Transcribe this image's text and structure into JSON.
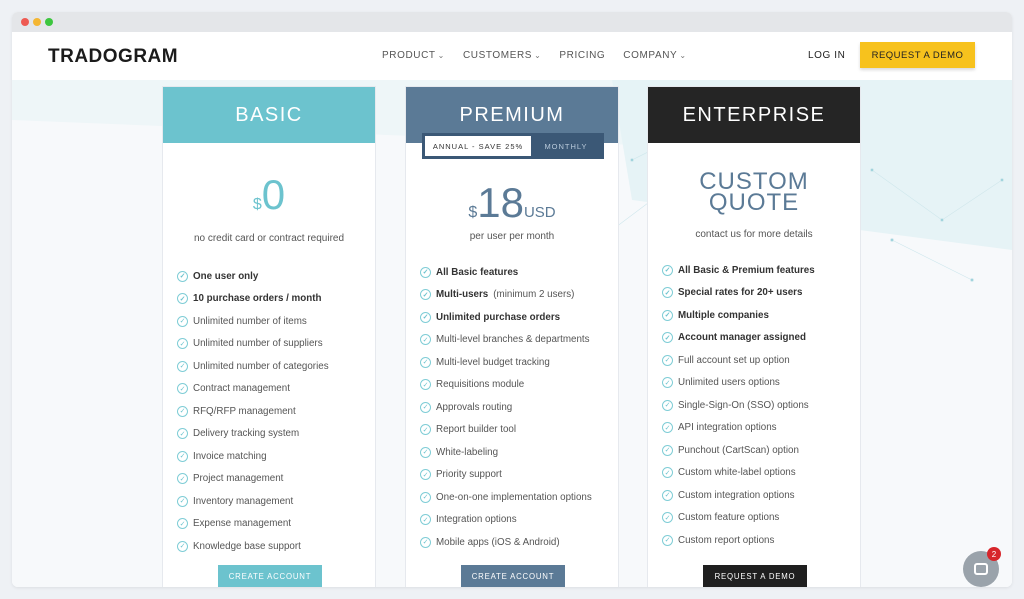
{
  "browser": {
    "controls": [
      "close",
      "minimize",
      "maximize"
    ]
  },
  "header": {
    "logo": "TRADOGRAM",
    "nav": [
      {
        "label": "PRODUCT",
        "dropdown": true
      },
      {
        "label": "CUSTOMERS",
        "dropdown": true
      },
      {
        "label": "PRICING",
        "dropdown": false
      },
      {
        "label": "COMPANY",
        "dropdown": true
      }
    ],
    "login": "LOG IN",
    "demo": "REQUEST A DEMO"
  },
  "plans": {
    "basic": {
      "name": "BASIC",
      "currency": "$",
      "amount": "0",
      "sub": "no credit card or contract required",
      "features": [
        {
          "text": "One user only",
          "bold": true
        },
        {
          "text": "10 purchase orders / month",
          "bold": true
        },
        {
          "text": "Unlimited number of items"
        },
        {
          "text": "Unlimited number of suppliers"
        },
        {
          "text": "Unlimited number of categories"
        },
        {
          "text": "Contract management"
        },
        {
          "text": "RFQ/RFP management"
        },
        {
          "text": "Delivery tracking system"
        },
        {
          "text": "Invoice matching"
        },
        {
          "text": "Project management"
        },
        {
          "text": "Inventory management"
        },
        {
          "text": "Expense management"
        },
        {
          "text": "Knowledge base support"
        }
      ],
      "cta": "CREATE ACCOUNT"
    },
    "premium": {
      "name": "PREMIUM",
      "toggle_on": "ANNUAL - SAVE 25%",
      "toggle_off": "MONTHLY",
      "currency": "$",
      "amount": "18",
      "unit": "USD",
      "sub": "per user per month",
      "features": [
        {
          "text": "All Basic features",
          "bold": true
        },
        {
          "text": "Multi-users",
          "bold": true,
          "note": " (minimum 2 users)"
        },
        {
          "text": "Unlimited purchase orders",
          "bold": true
        },
        {
          "text": "Multi-level branches & departments"
        },
        {
          "text": "Multi-level budget tracking"
        },
        {
          "text": "Requisitions module"
        },
        {
          "text": "Approvals routing"
        },
        {
          "text": "Report builder tool"
        },
        {
          "text": "White-labeling"
        },
        {
          "text": "Priority support"
        },
        {
          "text": "One-on-one implementation options"
        },
        {
          "text": "Integration options"
        },
        {
          "text": "Mobile apps (iOS & Android)"
        }
      ],
      "cta": "CREATE ACCOUNT"
    },
    "enterprise": {
      "name": "ENTERPRISE",
      "quote_line1": "CUSTOM",
      "quote_line2": "QUOTE",
      "sub": "contact us for more details",
      "features": [
        {
          "text": "All Basic & Premium features",
          "bold": true
        },
        {
          "text": "Special rates for 20+ users",
          "bold": true
        },
        {
          "text": "Multiple companies",
          "bold": true
        },
        {
          "text": "Account manager assigned",
          "bold": true
        },
        {
          "text": "Full account set up option"
        },
        {
          "text": "Unlimited users options"
        },
        {
          "text": "Single-Sign-On (SSO) options"
        },
        {
          "text": "API integration options"
        },
        {
          "text": "Punchout (CartScan) option"
        },
        {
          "text": "Custom white-label options"
        },
        {
          "text": "Custom integration options"
        },
        {
          "text": "Custom feature options"
        },
        {
          "text": "Custom report options"
        }
      ],
      "cta": "REQUEST A DEMO"
    }
  },
  "chat": {
    "badge": "2"
  },
  "colors": {
    "basic": "#6cc3ce",
    "premium": "#5b7a96",
    "enterprise": "#252525",
    "demo_button": "#f7c21d"
  }
}
